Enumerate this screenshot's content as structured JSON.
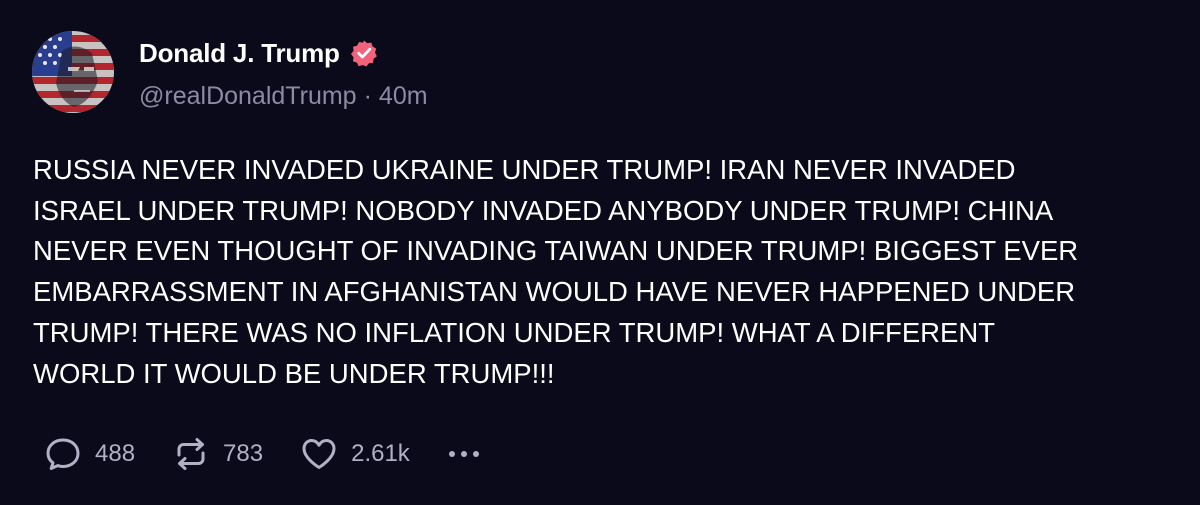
{
  "post": {
    "author": {
      "display_name": "Donald J. Trump",
      "handle": "@realDonaldTrump",
      "verified": true
    },
    "separator": "·",
    "timestamp": "40m",
    "body": "RUSSIA NEVER INVADED UKRAINE UNDER TRUMP! IRAN NEVER INVADED\nISRAEL UNDER TRUMP! NOBODY INVADED ANYBODY UNDER TRUMP! CHINA\nNEVER EVEN THOUGHT OF INVADING TAIWAN UNDER TRUMP! BIGGEST EVER\nEMBARRASSMENT IN AFGHANISTAN WOULD HAVE NEVER HAPPENED UNDER\nTRUMP! THERE WAS NO INFLATION UNDER TRUMP! WHAT A DIFFERENT\nWORLD IT WOULD BE UNDER TRUMP!!!",
    "stats": {
      "replies": "488",
      "reposts": "783",
      "likes": "2.61k"
    }
  },
  "icons": {
    "reply": "reply-bubble-icon",
    "repost": "repost-arrows-icon",
    "like": "heart-icon",
    "more": "more-dots-icon",
    "verified": "verified-badge-icon"
  },
  "colors": {
    "background": "#0b0a1b",
    "text": "#ffffff",
    "muted": "#8d8aa3",
    "icon": "#b3b0c6",
    "verified_badge": "#f2627a"
  }
}
